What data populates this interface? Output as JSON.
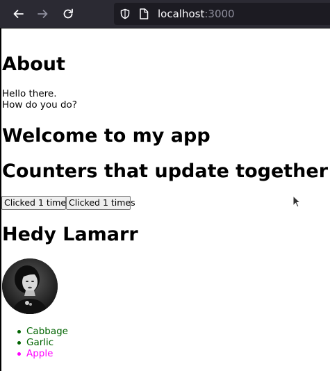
{
  "browser": {
    "url_host": "localhost",
    "url_port": ":3000",
    "colors": {
      "toolbar": "#2b2a33",
      "urlbar": "#1c1b22",
      "icon": "#fbfbfe"
    },
    "icons": [
      "back-arrow-icon",
      "forward-arrow-icon",
      "reload-icon",
      "shield-icon",
      "page-icon"
    ]
  },
  "page": {
    "about": {
      "title": "About",
      "lines": [
        "Hello there.",
        "How do you do?"
      ]
    },
    "welcome_title": "Welcome to my app",
    "counters": {
      "title": "Counters that update together",
      "buttons": [
        "Clicked 1 times",
        "Clicked 1 times"
      ]
    },
    "profile": {
      "name": "Hedy Lamarr"
    },
    "products": [
      {
        "label": "Cabbage",
        "color": "#006400"
      },
      {
        "label": "Garlic",
        "color": "#006400"
      },
      {
        "label": "Apple",
        "color": "#ff00ff"
      }
    ]
  }
}
